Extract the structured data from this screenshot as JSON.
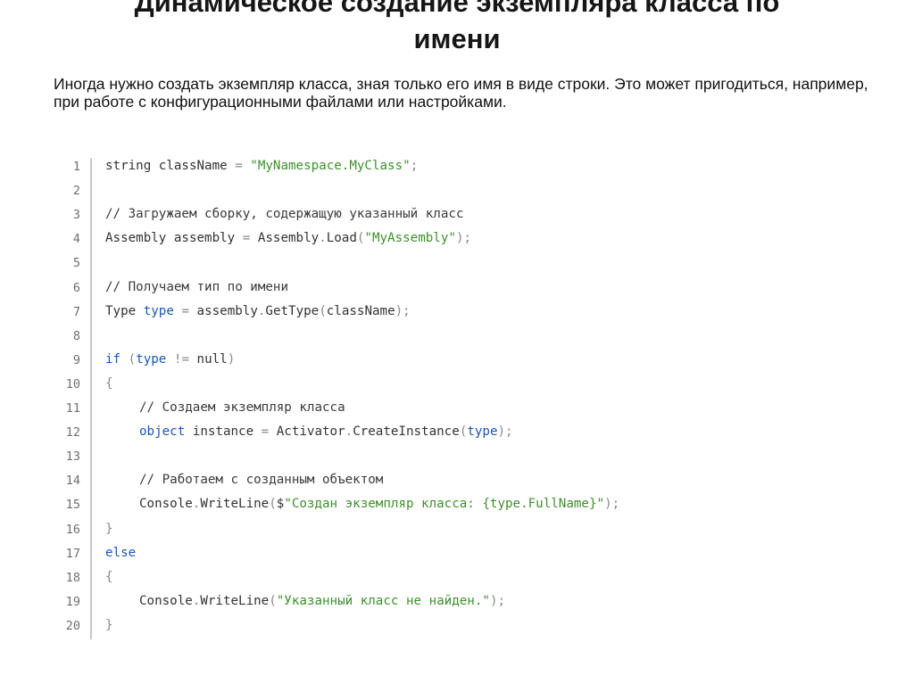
{
  "title": {
    "line1": "Динамическое создание экземпляра класса по",
    "line2": "имени"
  },
  "intro": "Иногда нужно создать экземпляр класса, зная только его имя в виде строки. Это может пригодиться, например, при работе с конфигурационными файлами или настройками.",
  "colors": {
    "keyword": "#1a56b0",
    "string": "#3f8f2e",
    "comment": "#3b3b3b",
    "text": "#333333",
    "punctuation": "#8a8a8a",
    "line_numbers": "#6f6f6f",
    "gutter_rule": "#c8c8c8"
  },
  "code": {
    "language": "C#",
    "lines": [
      {
        "n": "1",
        "indent": 0,
        "tokens": [
          {
            "t": "string className ",
            "k": "plain"
          },
          {
            "t": "=",
            "k": "punct"
          },
          {
            "t": " ",
            "k": "plain"
          },
          {
            "t": "\"MyNamespace.MyClass\"",
            "k": "string"
          },
          {
            "t": ";",
            "k": "punct"
          }
        ]
      },
      {
        "n": "2",
        "indent": 0,
        "tokens": []
      },
      {
        "n": "3",
        "indent": 0,
        "tokens": [
          {
            "t": "// Загружаем сборку, содержащую указанный класс",
            "k": "comment"
          }
        ]
      },
      {
        "n": "4",
        "indent": 0,
        "tokens": [
          {
            "t": "Assembly assembly ",
            "k": "plain"
          },
          {
            "t": "=",
            "k": "punct"
          },
          {
            "t": " Assembly",
            "k": "plain"
          },
          {
            "t": ".",
            "k": "punct"
          },
          {
            "t": "Load",
            "k": "plain"
          },
          {
            "t": "(",
            "k": "punct"
          },
          {
            "t": "\"MyAssembly\"",
            "k": "string"
          },
          {
            "t": ");",
            "k": "punct"
          }
        ]
      },
      {
        "n": "5",
        "indent": 0,
        "tokens": []
      },
      {
        "n": "6",
        "indent": 0,
        "tokens": [
          {
            "t": "// Получаем тип по имени",
            "k": "comment"
          }
        ]
      },
      {
        "n": "7",
        "indent": 0,
        "tokens": [
          {
            "t": "Type ",
            "k": "plain"
          },
          {
            "t": "type",
            "k": "keyword"
          },
          {
            "t": " ",
            "k": "plain"
          },
          {
            "t": "=",
            "k": "punct"
          },
          {
            "t": " assembly",
            "k": "plain"
          },
          {
            "t": ".",
            "k": "punct"
          },
          {
            "t": "GetType",
            "k": "plain"
          },
          {
            "t": "(",
            "k": "punct"
          },
          {
            "t": "className",
            "k": "plain"
          },
          {
            "t": ");",
            "k": "punct"
          }
        ]
      },
      {
        "n": "8",
        "indent": 0,
        "tokens": []
      },
      {
        "n": "9",
        "indent": 0,
        "tokens": [
          {
            "t": "if",
            "k": "keyword"
          },
          {
            "t": " ",
            "k": "plain"
          },
          {
            "t": "(",
            "k": "punct"
          },
          {
            "t": "type",
            "k": "keyword"
          },
          {
            "t": " ",
            "k": "plain"
          },
          {
            "t": "!=",
            "k": "punct"
          },
          {
            "t": " null",
            "k": "plain"
          },
          {
            "t": ")",
            "k": "punct"
          }
        ]
      },
      {
        "n": "10",
        "indent": 0,
        "tokens": [
          {
            "t": "{",
            "k": "punct"
          }
        ]
      },
      {
        "n": "11",
        "indent": 1,
        "tokens": [
          {
            "t": "// Создаем экземпляр класса",
            "k": "comment"
          }
        ]
      },
      {
        "n": "12",
        "indent": 1,
        "tokens": [
          {
            "t": "object",
            "k": "keyword"
          },
          {
            "t": " instance ",
            "k": "plain"
          },
          {
            "t": "=",
            "k": "punct"
          },
          {
            "t": " Activator",
            "k": "plain"
          },
          {
            "t": ".",
            "k": "punct"
          },
          {
            "t": "CreateInstance",
            "k": "plain"
          },
          {
            "t": "(",
            "k": "punct"
          },
          {
            "t": "type",
            "k": "keyword"
          },
          {
            "t": ");",
            "k": "punct"
          }
        ]
      },
      {
        "n": "13",
        "indent": 0,
        "tokens": []
      },
      {
        "n": "14",
        "indent": 1,
        "tokens": [
          {
            "t": "// Работаем с созданным объектом",
            "k": "comment"
          }
        ]
      },
      {
        "n": "15",
        "indent": 1,
        "tokens": [
          {
            "t": "Console",
            "k": "plain"
          },
          {
            "t": ".",
            "k": "punct"
          },
          {
            "t": "WriteLine",
            "k": "plain"
          },
          {
            "t": "(",
            "k": "punct"
          },
          {
            "t": "$",
            "k": "plain"
          },
          {
            "t": "\"Создан экземпляр класса: {type.FullName}\"",
            "k": "string"
          },
          {
            "t": ");",
            "k": "punct"
          }
        ]
      },
      {
        "n": "16",
        "indent": 0,
        "tokens": [
          {
            "t": "}",
            "k": "punct"
          }
        ]
      },
      {
        "n": "17",
        "indent": 0,
        "tokens": [
          {
            "t": "else",
            "k": "keyword"
          }
        ]
      },
      {
        "n": "18",
        "indent": 0,
        "tokens": [
          {
            "t": "{",
            "k": "punct"
          }
        ]
      },
      {
        "n": "19",
        "indent": 1,
        "tokens": [
          {
            "t": "Console",
            "k": "plain"
          },
          {
            "t": ".",
            "k": "punct"
          },
          {
            "t": "WriteLine",
            "k": "plain"
          },
          {
            "t": "(",
            "k": "punct"
          },
          {
            "t": "\"Указанный класс не найден.\"",
            "k": "string"
          },
          {
            "t": ");",
            "k": "punct"
          }
        ]
      },
      {
        "n": "20",
        "indent": 0,
        "tokens": [
          {
            "t": "}",
            "k": "punct"
          }
        ]
      }
    ]
  }
}
